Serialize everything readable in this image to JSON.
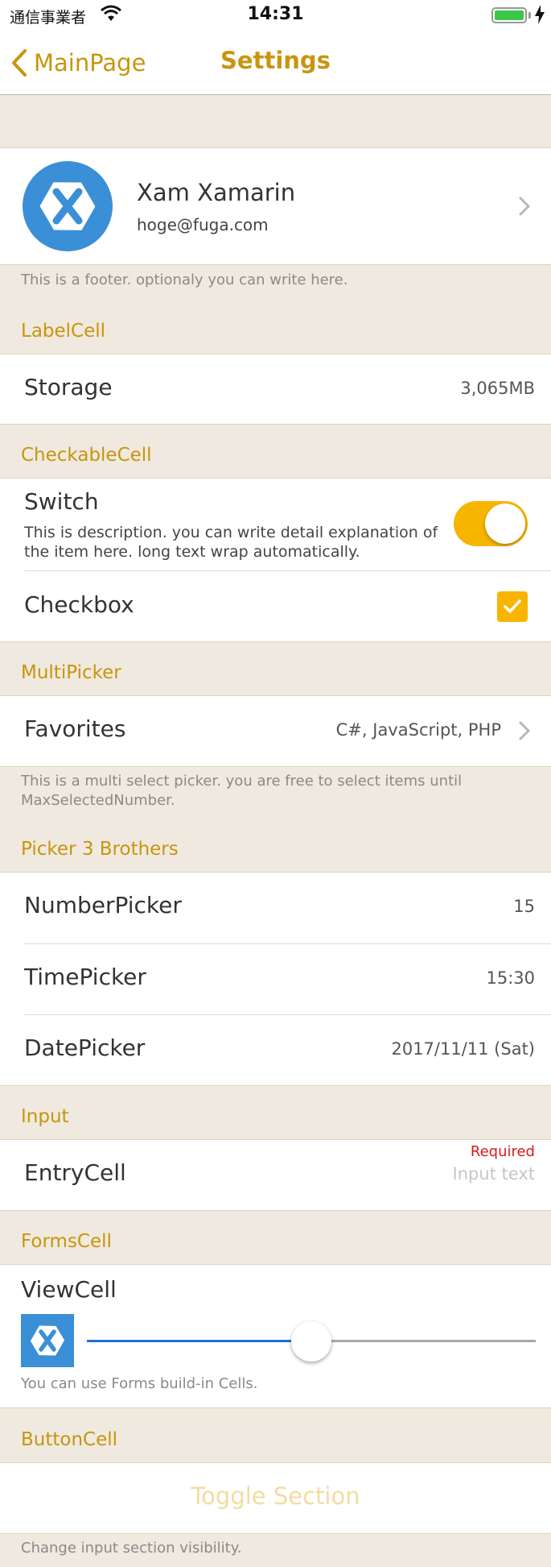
{
  "status": {
    "carrier": "通信事業者",
    "time": "14:31"
  },
  "nav": {
    "back_label": "MainPage",
    "title": "Settings"
  },
  "profile": {
    "name": "Xam Xamarin",
    "email": "hoge@fuga.com",
    "footer": "This is a footer. optionaly you can write here."
  },
  "label_section": {
    "header": "LabelCell",
    "storage_title": "Storage",
    "storage_value": "3,065MB"
  },
  "checkable_section": {
    "header": "CheckableCell",
    "switch_title": "Switch",
    "switch_description": "This is description. you can write detail explanation of the item here. long text wrap automatically.",
    "switch_on": true,
    "checkbox_title": "Checkbox",
    "checkbox_checked": true
  },
  "multipicker_section": {
    "header": "MultiPicker",
    "favorites_title": "Favorites",
    "favorites_value": "C#, JavaScript, PHP",
    "footer": "This is a multi select picker. you are free to select items until MaxSelectedNumber."
  },
  "picker_section": {
    "header": "Picker 3 Brothers",
    "number_title": "NumberPicker",
    "number_value": "15",
    "time_title": "TimePicker",
    "time_value": "15:30",
    "date_title": "DatePicker",
    "date_value": "2017/11/11 (Sat)"
  },
  "input_section": {
    "header": "Input",
    "entry_title": "EntryCell",
    "required_label": "Required",
    "entry_placeholder": "Input text"
  },
  "forms_section": {
    "header": "FormsCell",
    "viewcell_title": "ViewCell",
    "slider_value": 0.5,
    "caption": "You can use Forms build-in Cells."
  },
  "button_section": {
    "header": "ButtonCell",
    "button_label": "Toggle Section",
    "footer": "Change input section visibility."
  },
  "colors": {
    "accent": "#c8950c",
    "toggle": "#f7b500",
    "background": "#efe9df",
    "logo_blue": "#3a8fd7"
  }
}
